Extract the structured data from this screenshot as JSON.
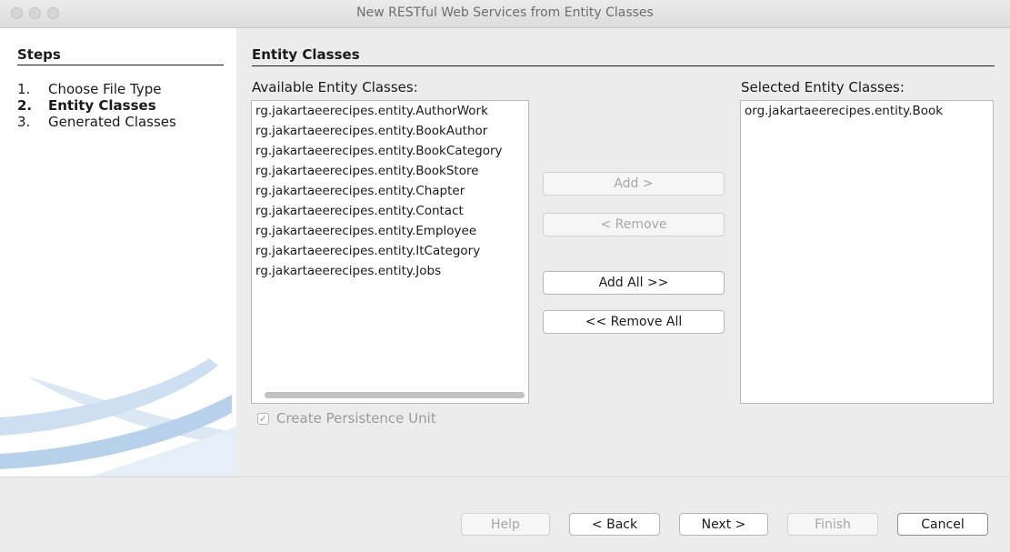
{
  "window": {
    "title": "New RESTful Web Services from Entity Classes"
  },
  "steps": {
    "heading": "Steps",
    "items": [
      {
        "num": "1.",
        "label": "Choose File Type",
        "active": false
      },
      {
        "num": "2.",
        "label": "Entity Classes",
        "active": true
      },
      {
        "num": "3.",
        "label": "Generated Classes",
        "active": false
      }
    ]
  },
  "content": {
    "title": "Entity Classes",
    "available_label": "Available Entity Classes:",
    "selected_label": "Selected Entity Classes:",
    "available": [
      "rg.jakartaeerecipes.entity.AuthorWork",
      "rg.jakartaeerecipes.entity.BookAuthor",
      "rg.jakartaeerecipes.entity.BookCategory",
      "rg.jakartaeerecipes.entity.BookStore",
      "rg.jakartaeerecipes.entity.Chapter",
      "rg.jakartaeerecipes.entity.Contact",
      "rg.jakartaeerecipes.entity.Employee",
      "rg.jakartaeerecipes.entity.ItCategory",
      "rg.jakartaeerecipes.entity.Jobs"
    ],
    "selected": [
      "org.jakartaeerecipes.entity.Book"
    ],
    "buttons": {
      "add": "Add >",
      "remove": "< Remove",
      "add_all": "Add All >>",
      "remove_all": "<< Remove All"
    },
    "create_pu": {
      "label": "Create Persistence Unit",
      "checked": true,
      "enabled": false
    }
  },
  "footer": {
    "help": "Help",
    "back": "< Back",
    "next": "Next >",
    "finish": "Finish",
    "cancel": "Cancel"
  },
  "icons": {
    "checkmark": "✓"
  }
}
